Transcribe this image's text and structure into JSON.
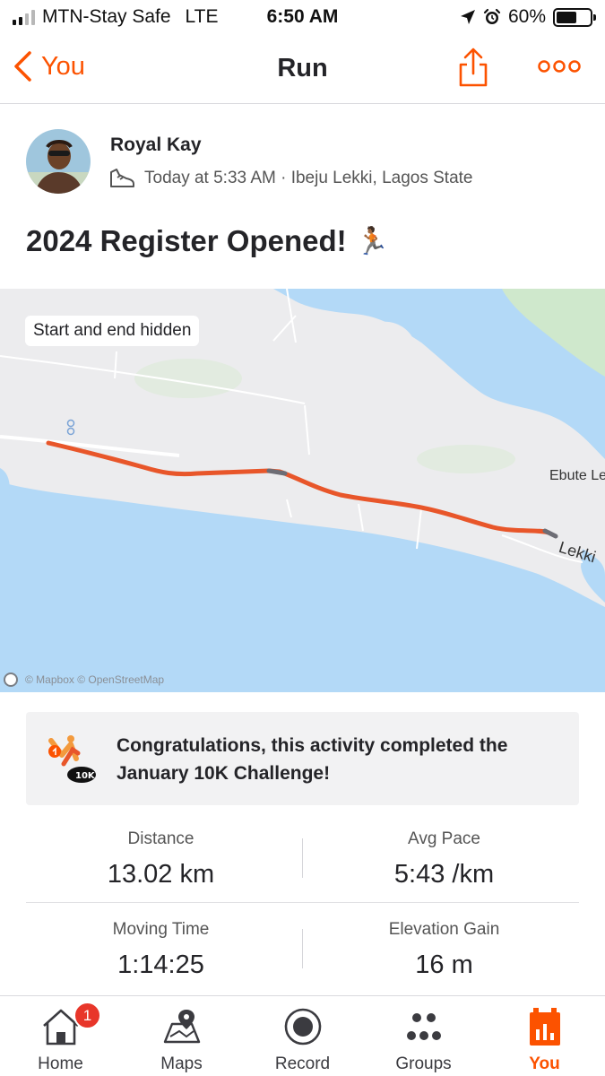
{
  "status_bar": {
    "carrier": "MTN-Stay Safe",
    "network": "LTE",
    "time": "6:50 AM",
    "battery": "60%",
    "battery_level": 0.6
  },
  "nav": {
    "back_label": "You",
    "title": "Run"
  },
  "activity": {
    "athlete_name": "Royal Kay",
    "meta": "Today at 5:33 AM · Ibeju Lekki, Lagos State",
    "title": "2024 Register Opened!",
    "title_emoji": "🏃🏾",
    "map": {
      "hidden_badge": "Start and end hidden",
      "place_labels": [
        "Ebute Le",
        "Lekki"
      ],
      "attribution": "© Mapbox © OpenStreetMap"
    },
    "challenge": {
      "message": "Congratulations, this activity completed the January 10K Challenge!",
      "badge_text": "10K"
    },
    "stats": [
      {
        "label": "Distance",
        "value": "13.02 km"
      },
      {
        "label": "Avg Pace",
        "value": "5:43 /km"
      },
      {
        "label": "Moving Time",
        "value": "1:14:25"
      },
      {
        "label": "Elevation Gain",
        "value": "16 m"
      }
    ]
  },
  "tabbar": {
    "items": [
      {
        "label": "Home",
        "icon": "home-icon"
      },
      {
        "label": "Maps",
        "icon": "maps-icon"
      },
      {
        "label": "Record",
        "icon": "record-icon"
      },
      {
        "label": "Groups",
        "icon": "groups-icon"
      },
      {
        "label": "You",
        "icon": "you-icon",
        "active": true
      }
    ],
    "home_badge": "1"
  },
  "colors": {
    "accent": "#fc5200",
    "route": "#e8562a",
    "water": "#b3d9f7",
    "land": "#ececee"
  }
}
